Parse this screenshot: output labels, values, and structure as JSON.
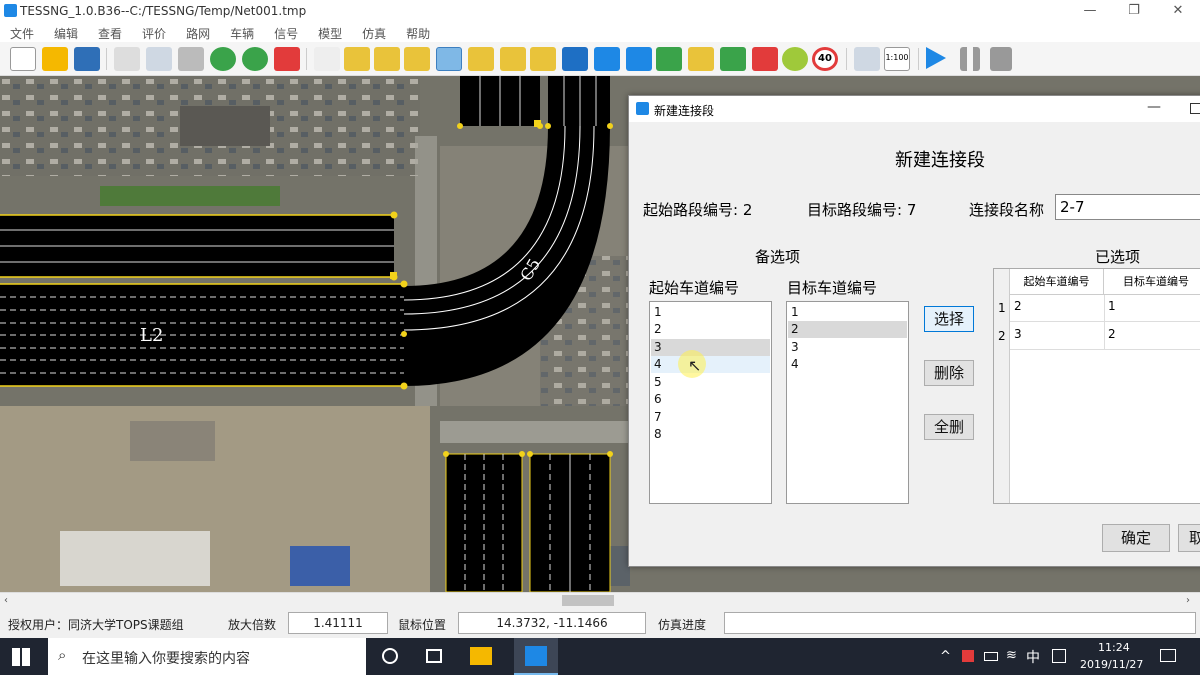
{
  "window": {
    "title": "TESSNG_1.0.B36--C:/TESSNG/Temp/Net001.tmp",
    "min": "—",
    "max": "❐",
    "close": "✕"
  },
  "menu": [
    "文件",
    "编辑",
    "查看",
    "评价",
    "路网",
    "车辆",
    "信号",
    "模型",
    "仿真",
    "帮助"
  ],
  "toolbar": {
    "scale_label": "1:100",
    "icons": [
      "new-icon",
      "open-icon",
      "save-icon",
      "pan-icon",
      "select-area-icon",
      "ruler-icon",
      "zoom-in-icon",
      "zoom-out-icon",
      "fit-icon",
      "pointer-icon",
      "link-icon",
      "connector-icon",
      "lane-icon",
      "connector-active-icon",
      "decision-icon",
      "route-icon",
      "vehicle-icon",
      "direction-icon",
      "bus-icon",
      "bus-stop-icon",
      "parking-icon",
      "signal-icon",
      "detector-icon",
      "incident-icon",
      "speed-icon",
      "speed-limit-icon",
      "config-icon",
      "scale-icon",
      "play-icon",
      "pause-icon",
      "stop-icon"
    ],
    "speed_limit": "40"
  },
  "map": {
    "link_label": "L2",
    "connector_label": "C5"
  },
  "dialog": {
    "title": "新建连接段",
    "heading": "新建连接段",
    "from_link_label": "起始路段编号: 2",
    "to_link_label": "目标路段编号: 7",
    "name_label": "连接段名称",
    "name_value": "2-7",
    "available_header": "备选项",
    "selected_header": "已选项",
    "from_lane_header": "起始车道编号",
    "to_lane_header": "目标车道编号",
    "from_lanes": [
      "1",
      "2",
      "3",
      "4",
      "5",
      "6",
      "7",
      "8"
    ],
    "to_lanes": [
      "1",
      "2",
      "3",
      "4"
    ],
    "from_selected": "3",
    "to_selected": "2",
    "buttons": {
      "select": "选择",
      "delete": "删除",
      "delete_all": "全删",
      "ok": "确定",
      "cancel": "取"
    },
    "table": {
      "columns": [
        "起始车道编号",
        "目标车道编号"
      ],
      "rows": [
        {
          "idx": "1",
          "from": "2",
          "to": "1"
        },
        {
          "idx": "2",
          "from": "3",
          "to": "2"
        }
      ]
    }
  },
  "status": {
    "user": "授权用户：同济大学TOPS课题组",
    "zoom_label": "放大倍数",
    "zoom_value": "1.41111",
    "mouse_label": "鼠标位置",
    "mouse_value": "14.3732, -11.1466",
    "progress_label": "仿真进度"
  },
  "taskbar": {
    "search_placeholder": "在这里输入你要搜索的内容",
    "time": "11:24",
    "date": "2019/11/27",
    "ime": "中"
  }
}
